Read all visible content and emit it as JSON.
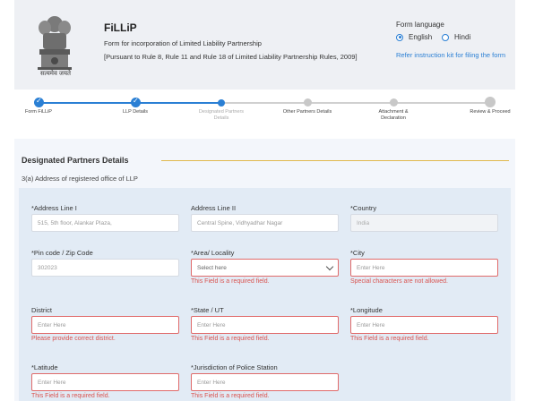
{
  "header": {
    "emblem_caption": "सत्यमेव जयते",
    "app_title": "FiLLiP",
    "app_subtitle": "Form for incorporation of Limited Liability Partnership",
    "app_rule": "[Pursuant to Rule 8, Rule 11 and Rule 18 of Limited Liability Partnership Rules, 2009]",
    "lang_heading": "Form language",
    "lang_english": "English",
    "lang_hindi": "Hindi",
    "lang_selected": "English",
    "kit_link": "Refer instruction kit for filing the form"
  },
  "stepper": {
    "steps": [
      {
        "label": "Form FiLLiP",
        "status": "done"
      },
      {
        "label": "LLP Details",
        "status": "done"
      },
      {
        "label": "Designated Partners Details",
        "status": "active"
      },
      {
        "label": "Other Partners Details",
        "status": "pending"
      },
      {
        "label": "Attachment & Declaration",
        "status": "pending"
      },
      {
        "label": "Review & Proceed",
        "status": "pending"
      }
    ]
  },
  "section": {
    "title": "Designated Partners Details",
    "subtitle": "3(a)   Address of registered office of LLP"
  },
  "form": {
    "address1": {
      "label": "*Address Line I",
      "value": "515, 5th floor, Alankar Plaza,"
    },
    "address2": {
      "label": "Address Line II",
      "value": "Central Spine, Vidhyadhar Nagar"
    },
    "country": {
      "label": "*Country",
      "value": "India"
    },
    "pincode": {
      "label": "*Pin code / Zip Code",
      "value": "302023"
    },
    "area": {
      "label": "*Area/ Locality",
      "value": "Select here",
      "error": "This Field is a required field."
    },
    "city": {
      "label": "*City",
      "placeholder": "Enter Here",
      "error": "Special characters are not allowed."
    },
    "district": {
      "label": "District",
      "placeholder": "Enter Here",
      "error": "Please provide correct district."
    },
    "state": {
      "label": "*State / UT",
      "placeholder": "Enter Here",
      "error": "This Field is a required field."
    },
    "longitude": {
      "label": "*Longitude",
      "placeholder": "Enter Here",
      "error": "This Field is a required field."
    },
    "latitude": {
      "label": "*Latitude",
      "placeholder": "Enter Here",
      "error": "This Field is a required field."
    },
    "police": {
      "label": "*Jurisdiction of Police Station",
      "placeholder": "Enter Here",
      "error": "This Field is a required field."
    }
  },
  "colors": {
    "accent": "#2a7fd4",
    "error": "#d9534f",
    "divider": "#e0b84c"
  }
}
